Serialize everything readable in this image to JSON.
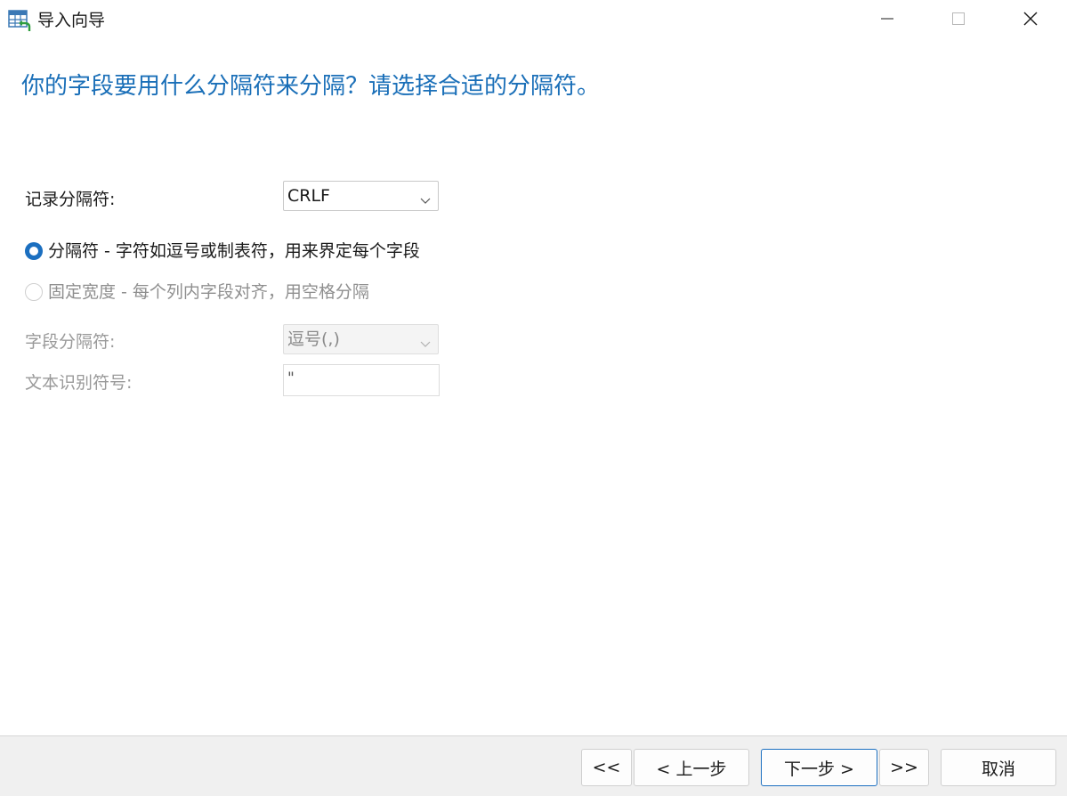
{
  "window": {
    "title": "导入向导",
    "icon": "table-import-icon",
    "controls": {
      "minimize_icon": "minimize-icon",
      "maximize_icon": "maximize-icon",
      "close_icon": "close-icon"
    }
  },
  "heading": "你的字段要用什么分隔符来分隔？请选择合适的分隔符。",
  "form": {
    "record_delimiter": {
      "label": "记录分隔符:",
      "value": "CRLF"
    },
    "mode_options": [
      {
        "label": "分隔符 - 字符如逗号或制表符，用来界定每个字段",
        "checked": true,
        "enabled": true
      },
      {
        "label": "固定宽度 - 每个列内字段对齐，用空格分隔",
        "checked": false,
        "enabled": false
      }
    ],
    "field_delimiter": {
      "label": "字段分隔符:",
      "value": "逗号(,)",
      "enabled": false
    },
    "text_qualifier": {
      "label": "文本识别符号:",
      "value": "\"",
      "enabled": false
    }
  },
  "footer": {
    "first_label": "<<",
    "prev_label": "< 上一步",
    "next_label": "下一步 >",
    "last_label": ">>",
    "cancel_label": "取消"
  },
  "colors": {
    "heading": "#1a6fb8",
    "accent": "#1b6fc0",
    "footer_bg": "#f0f0f0",
    "disabled_text": "#9a9a9a"
  }
}
